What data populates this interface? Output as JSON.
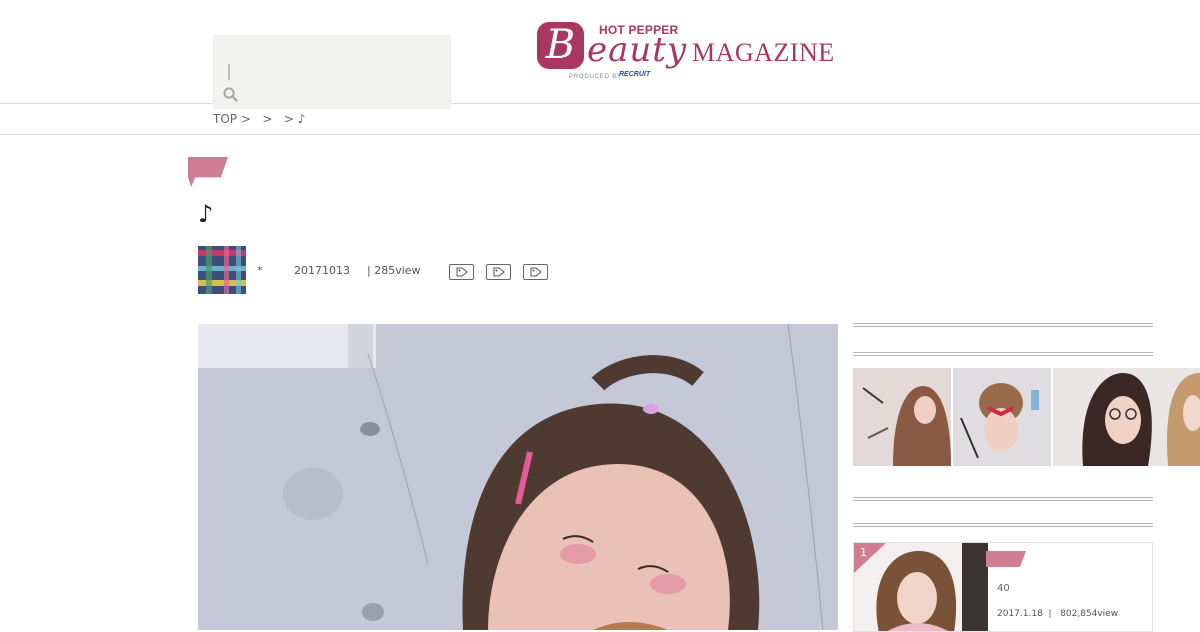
{
  "header": {
    "logo": {
      "hot_pepper": "HOT PEPPER",
      "b": "B",
      "eauty": "eauty",
      "magazine": "MAGAZINE",
      "produced_by": "PRODUCED BY",
      "recruit": "RECRUIT"
    },
    "search": {
      "value": "",
      "icon": "search-icon"
    }
  },
  "breadcrumb": {
    "text": "TOP >   >   > ♪"
  },
  "article": {
    "title": "♪",
    "author": "*",
    "date": "20171013",
    "views": "| 285view",
    "tags": [
      "tag-icon",
      "tag-icon",
      "tag-icon"
    ]
  },
  "sidebar": {
    "ranking": {
      "rank": "1",
      "count": "40",
      "meta": "2017.1.18  |   802,854view"
    }
  },
  "colors": {
    "brand": "#a8385f",
    "accent_pink": "#cf7d93"
  }
}
